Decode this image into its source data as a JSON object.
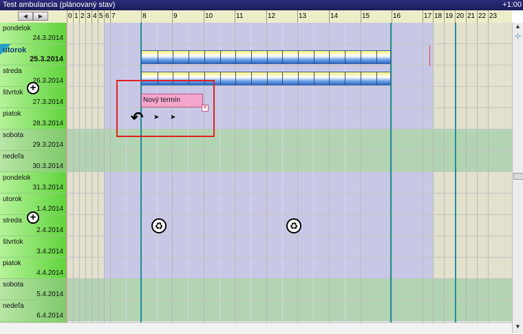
{
  "window": {
    "title": "Test ambulancia (plánovaný stav)",
    "zoom_label": "+1:00"
  },
  "nav": {
    "prev_icon": "◀",
    "next_icon": "▶"
  },
  "hours": [
    "0",
    "1",
    "2",
    "3",
    "4",
    "5",
    "6",
    "7",
    "8",
    "9",
    "10",
    "11",
    "12",
    "13",
    "14",
    "15",
    "16",
    "17",
    "18",
    "19",
    "20",
    "21",
    "22",
    "23"
  ],
  "days": [
    {
      "name": "pondelok",
      "date": "24.3.2014"
    },
    {
      "name": "utorok",
      "date": "25.3.2014"
    },
    {
      "name": "streda",
      "date": "26.3.2014"
    },
    {
      "name": "štvrtok",
      "date": "27.3.2014"
    },
    {
      "name": "piatok",
      "date": "28.3.2014"
    },
    {
      "name": "sobota",
      "date": "29.3.2014"
    },
    {
      "name": "nedeľa",
      "date": "30.3.2014"
    },
    {
      "name": "pondelok",
      "date": "31.3.2014"
    },
    {
      "name": "utorok",
      "date": "1.4.2014"
    },
    {
      "name": "streda",
      "date": "2.4.2014"
    },
    {
      "name": "štvrtok",
      "date": "3.4.2014"
    },
    {
      "name": "piatok",
      "date": "4.4.2014"
    },
    {
      "name": "sobota",
      "date": "5.4.2014"
    },
    {
      "name": "nedeľa",
      "date": "6.4.2014"
    }
  ],
  "new_appointment": {
    "label": "Nový termín"
  },
  "colors": {
    "work_area": "#c8c8e6",
    "off_hours": "#e2e1ce",
    "weekend": "#b3d4b3",
    "day_column": "#6fd84a",
    "teal_marker": "#1b8e95",
    "selection": "#e02020",
    "appointment": "#f4a6cd",
    "title_bar": "#1c1c5c"
  },
  "icons": {
    "plus": "+",
    "recycle": "♻",
    "arrow": "➤",
    "undo": "↶",
    "scroll_up": "▲",
    "scroll_down": "▼",
    "splitter": "⊹"
  }
}
